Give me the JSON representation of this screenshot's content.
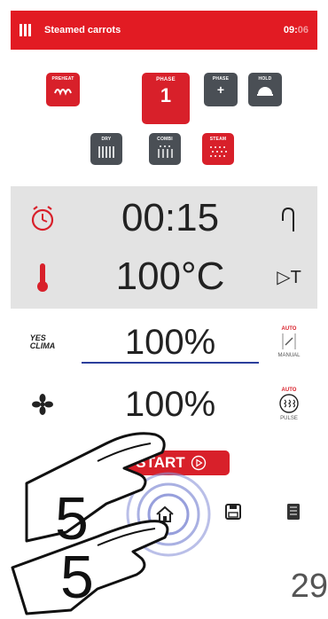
{
  "header": {
    "title": "Steamed carrots",
    "time_main": "09:",
    "time_dim": "06"
  },
  "buttons": {
    "preheat": "PREHEAT",
    "phase": "PHASE",
    "phase_number": "1",
    "phase_add": "PHASE",
    "hold": "HOLD",
    "dry": "DRY",
    "combi": "COMBI",
    "steam": "STEAM"
  },
  "settings": {
    "time": "00:15",
    "temperature": "100°C",
    "delta_t": "▷T",
    "humidity": "100%",
    "fan": "100%",
    "yes_clima_line1": "YES",
    "yes_clima_line2": "CLIMA",
    "humidity_auto": "AUTO",
    "humidity_manual": "MANUAL",
    "fan_auto": "AUTO",
    "fan_pulse": "PULSE"
  },
  "start_label": "START",
  "overlay": {
    "digit_top": "5",
    "digit_bottom": "5"
  },
  "page_number": "29"
}
